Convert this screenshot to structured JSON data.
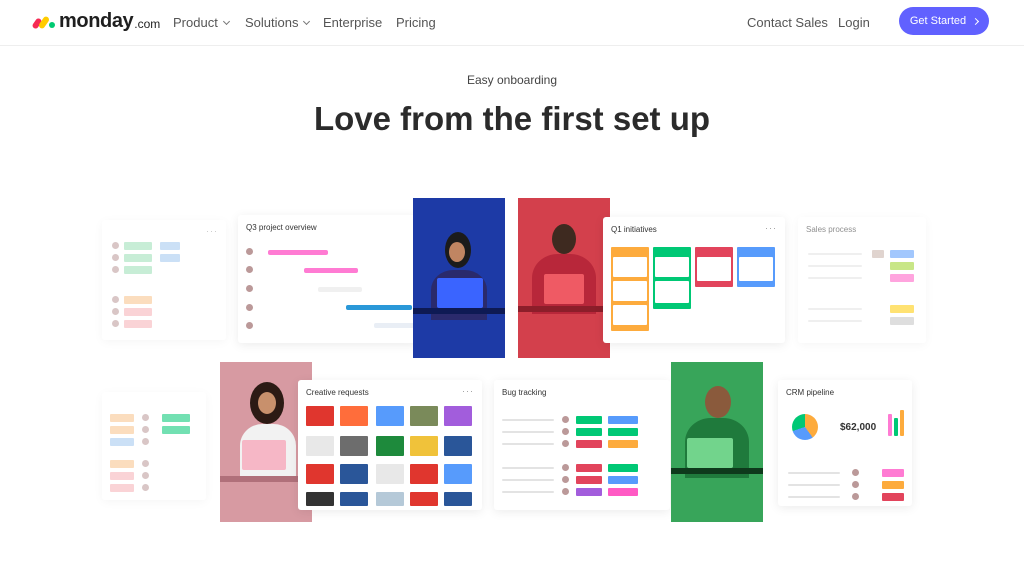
{
  "nav": {
    "logo_text": "monday",
    "logo_suffix": ".com",
    "links": [
      {
        "label": "Product"
      },
      {
        "label": "Solutions"
      },
      {
        "label": "Enterprise"
      },
      {
        "label": "Pricing"
      }
    ],
    "contact_sales": "Contact Sales",
    "login": "Login",
    "cta": "Get Started"
  },
  "hero": {
    "eyebrow": "Easy onboarding",
    "headline": "Love from the first set up"
  },
  "cards": {
    "q3": {
      "title": "Q3 project overview"
    },
    "q1": {
      "title": "Q1 initiatives"
    },
    "sales": {
      "title": "Sales process"
    },
    "creative": {
      "title": "Creative requests"
    },
    "bug": {
      "title": "Bug tracking"
    },
    "crm": {
      "title": "CRM pipeline",
      "value": "$62,000"
    }
  },
  "colors": {
    "accent": "#6161ff",
    "blue_photo": "#1d3aa6",
    "red_photo": "#d3404c",
    "pink_photo": "#d79aa2",
    "green_photo": "#38a55a"
  }
}
